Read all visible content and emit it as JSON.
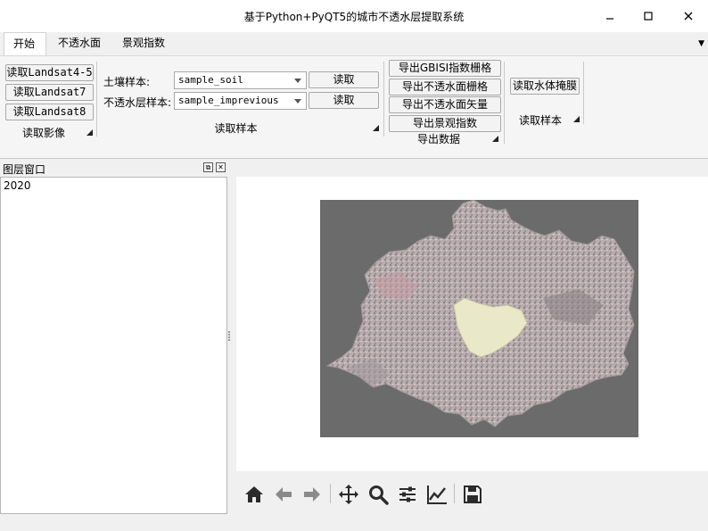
{
  "window": {
    "title": "基于Python+PyQT5的城市不透水层提取系统",
    "controls": {
      "minimize": "—",
      "maximize": "☐",
      "close": "✕"
    }
  },
  "tabs": [
    {
      "label": "开始",
      "active": true
    },
    {
      "label": "不透水面",
      "active": false
    },
    {
      "label": "景观指数",
      "active": false
    }
  ],
  "ribbon": {
    "read_image": {
      "buttons": [
        "读取Landsat4-5",
        "读取Landsat7",
        "读取Landsat8"
      ],
      "group_title": "读取影像"
    },
    "read_sample": {
      "soil_label": "土壤样本:",
      "soil_value": "sample_soil",
      "imp_label": "不透水层样本:",
      "imp_value": "sample_imprevious",
      "read_btn_1": "读取",
      "read_btn_2": "读取",
      "group_title": "读取样本"
    },
    "export": {
      "buttons": [
        "导出GBISI指数栅格",
        "导出不透水面栅格",
        "导出不透水面矢量",
        "导出景观指数"
      ],
      "group_title": "导出数据"
    },
    "water": {
      "button": "读取水体掩膜",
      "group_title": "读取样本"
    }
  },
  "layer_panel": {
    "title": "图层窗口",
    "items": [
      "2020"
    ]
  },
  "colors": {
    "map_background": "#6b6b6b",
    "canvas_background": "#ffffff",
    "icon_color": "#2b2b2b"
  },
  "toolbar_icons": [
    "home-icon",
    "back-arrow-icon",
    "forward-arrow-icon",
    "pan-icon",
    "zoom-icon",
    "configure-subplots-icon",
    "edit-axis-icon",
    "save-icon"
  ]
}
